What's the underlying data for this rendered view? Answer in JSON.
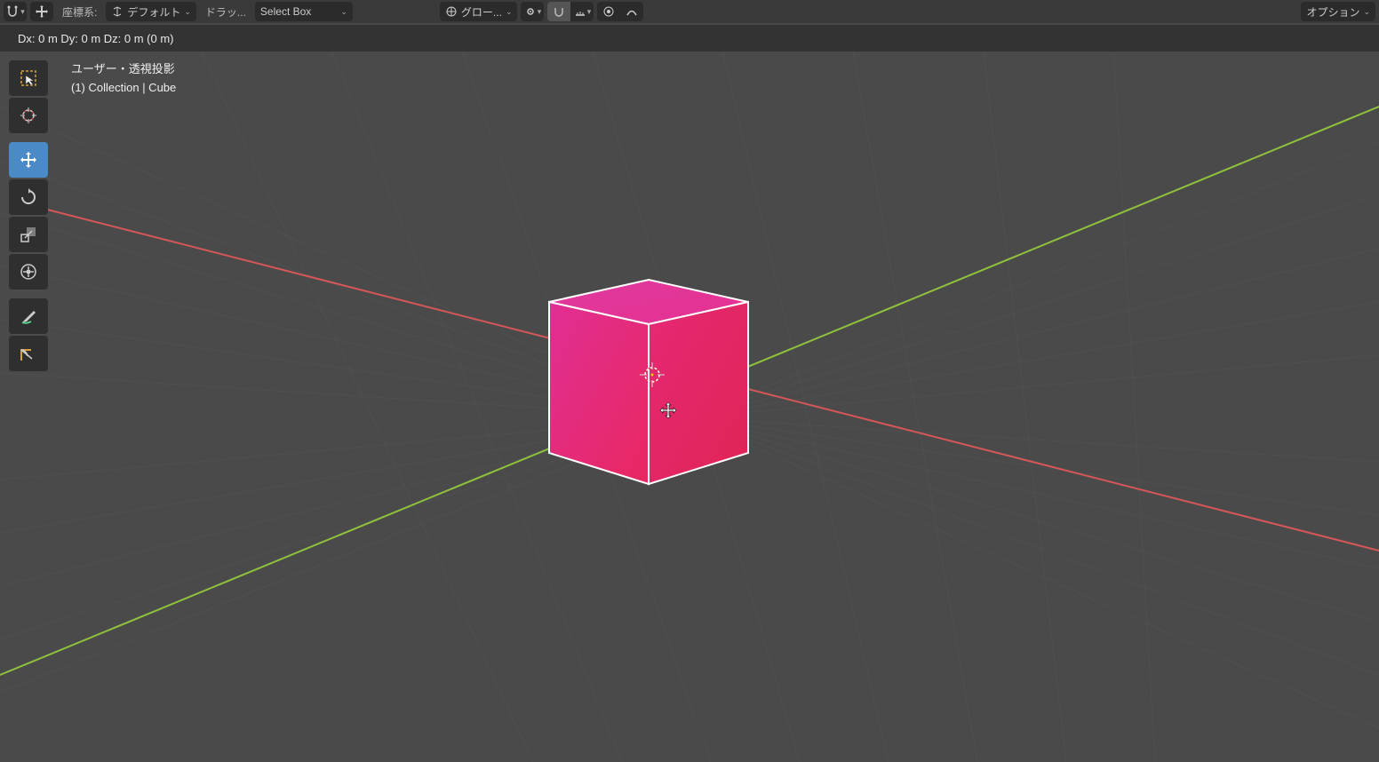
{
  "header": {
    "coord_system_label": "座標系:",
    "orientation_label": "デフォルト",
    "drag_label": "ドラッ...",
    "select_mode_label": "Select Box",
    "global_label": "グロー...",
    "options_label": "オプション"
  },
  "status": {
    "text": "Dx: 0 m   Dy: 0 m   Dz: 0 m (0 m)"
  },
  "overlay": {
    "line1": "ユーザー・透視投影",
    "line2": "(1) Collection | Cube"
  },
  "tools": {
    "select_box": "select-box",
    "cursor": "cursor",
    "move": "move",
    "rotate": "rotate",
    "scale": "scale",
    "transform": "transform",
    "annotate": "annotate",
    "measure": "measure"
  },
  "scene": {
    "object_name": "Cube",
    "collection": "Collection"
  }
}
